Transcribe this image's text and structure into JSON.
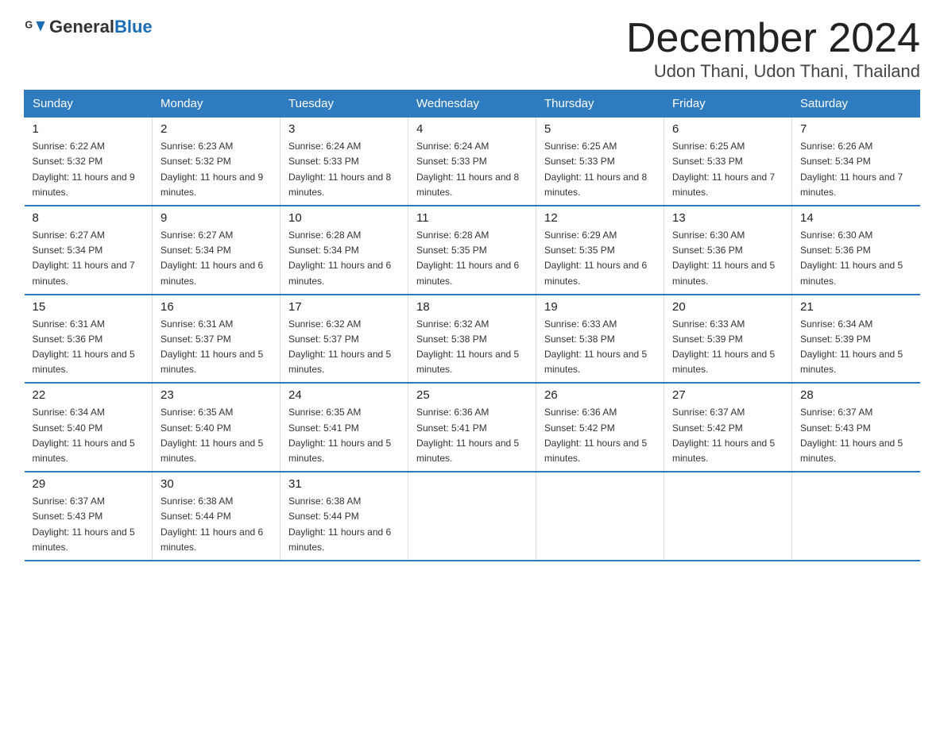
{
  "header": {
    "logo_general": "General",
    "logo_blue": "Blue",
    "month_title": "December 2024",
    "location": "Udon Thani, Udon Thani, Thailand"
  },
  "days_of_week": [
    "Sunday",
    "Monday",
    "Tuesday",
    "Wednesday",
    "Thursday",
    "Friday",
    "Saturday"
  ],
  "weeks": [
    [
      {
        "day": "1",
        "sunrise": "6:22 AM",
        "sunset": "5:32 PM",
        "daylight": "11 hours and 9 minutes."
      },
      {
        "day": "2",
        "sunrise": "6:23 AM",
        "sunset": "5:32 PM",
        "daylight": "11 hours and 9 minutes."
      },
      {
        "day": "3",
        "sunrise": "6:24 AM",
        "sunset": "5:33 PM",
        "daylight": "11 hours and 8 minutes."
      },
      {
        "day": "4",
        "sunrise": "6:24 AM",
        "sunset": "5:33 PM",
        "daylight": "11 hours and 8 minutes."
      },
      {
        "day": "5",
        "sunrise": "6:25 AM",
        "sunset": "5:33 PM",
        "daylight": "11 hours and 8 minutes."
      },
      {
        "day": "6",
        "sunrise": "6:25 AM",
        "sunset": "5:33 PM",
        "daylight": "11 hours and 7 minutes."
      },
      {
        "day": "7",
        "sunrise": "6:26 AM",
        "sunset": "5:34 PM",
        "daylight": "11 hours and 7 minutes."
      }
    ],
    [
      {
        "day": "8",
        "sunrise": "6:27 AM",
        "sunset": "5:34 PM",
        "daylight": "11 hours and 7 minutes."
      },
      {
        "day": "9",
        "sunrise": "6:27 AM",
        "sunset": "5:34 PM",
        "daylight": "11 hours and 6 minutes."
      },
      {
        "day": "10",
        "sunrise": "6:28 AM",
        "sunset": "5:34 PM",
        "daylight": "11 hours and 6 minutes."
      },
      {
        "day": "11",
        "sunrise": "6:28 AM",
        "sunset": "5:35 PM",
        "daylight": "11 hours and 6 minutes."
      },
      {
        "day": "12",
        "sunrise": "6:29 AM",
        "sunset": "5:35 PM",
        "daylight": "11 hours and 6 minutes."
      },
      {
        "day": "13",
        "sunrise": "6:30 AM",
        "sunset": "5:36 PM",
        "daylight": "11 hours and 5 minutes."
      },
      {
        "day": "14",
        "sunrise": "6:30 AM",
        "sunset": "5:36 PM",
        "daylight": "11 hours and 5 minutes."
      }
    ],
    [
      {
        "day": "15",
        "sunrise": "6:31 AM",
        "sunset": "5:36 PM",
        "daylight": "11 hours and 5 minutes."
      },
      {
        "day": "16",
        "sunrise": "6:31 AM",
        "sunset": "5:37 PM",
        "daylight": "11 hours and 5 minutes."
      },
      {
        "day": "17",
        "sunrise": "6:32 AM",
        "sunset": "5:37 PM",
        "daylight": "11 hours and 5 minutes."
      },
      {
        "day": "18",
        "sunrise": "6:32 AM",
        "sunset": "5:38 PM",
        "daylight": "11 hours and 5 minutes."
      },
      {
        "day": "19",
        "sunrise": "6:33 AM",
        "sunset": "5:38 PM",
        "daylight": "11 hours and 5 minutes."
      },
      {
        "day": "20",
        "sunrise": "6:33 AM",
        "sunset": "5:39 PM",
        "daylight": "11 hours and 5 minutes."
      },
      {
        "day": "21",
        "sunrise": "6:34 AM",
        "sunset": "5:39 PM",
        "daylight": "11 hours and 5 minutes."
      }
    ],
    [
      {
        "day": "22",
        "sunrise": "6:34 AM",
        "sunset": "5:40 PM",
        "daylight": "11 hours and 5 minutes."
      },
      {
        "day": "23",
        "sunrise": "6:35 AM",
        "sunset": "5:40 PM",
        "daylight": "11 hours and 5 minutes."
      },
      {
        "day": "24",
        "sunrise": "6:35 AM",
        "sunset": "5:41 PM",
        "daylight": "11 hours and 5 minutes."
      },
      {
        "day": "25",
        "sunrise": "6:36 AM",
        "sunset": "5:41 PM",
        "daylight": "11 hours and 5 minutes."
      },
      {
        "day": "26",
        "sunrise": "6:36 AM",
        "sunset": "5:42 PM",
        "daylight": "11 hours and 5 minutes."
      },
      {
        "day": "27",
        "sunrise": "6:37 AM",
        "sunset": "5:42 PM",
        "daylight": "11 hours and 5 minutes."
      },
      {
        "day": "28",
        "sunrise": "6:37 AM",
        "sunset": "5:43 PM",
        "daylight": "11 hours and 5 minutes."
      }
    ],
    [
      {
        "day": "29",
        "sunrise": "6:37 AM",
        "sunset": "5:43 PM",
        "daylight": "11 hours and 5 minutes."
      },
      {
        "day": "30",
        "sunrise": "6:38 AM",
        "sunset": "5:44 PM",
        "daylight": "11 hours and 6 minutes."
      },
      {
        "day": "31",
        "sunrise": "6:38 AM",
        "sunset": "5:44 PM",
        "daylight": "11 hours and 6 minutes."
      },
      null,
      null,
      null,
      null
    ]
  ]
}
